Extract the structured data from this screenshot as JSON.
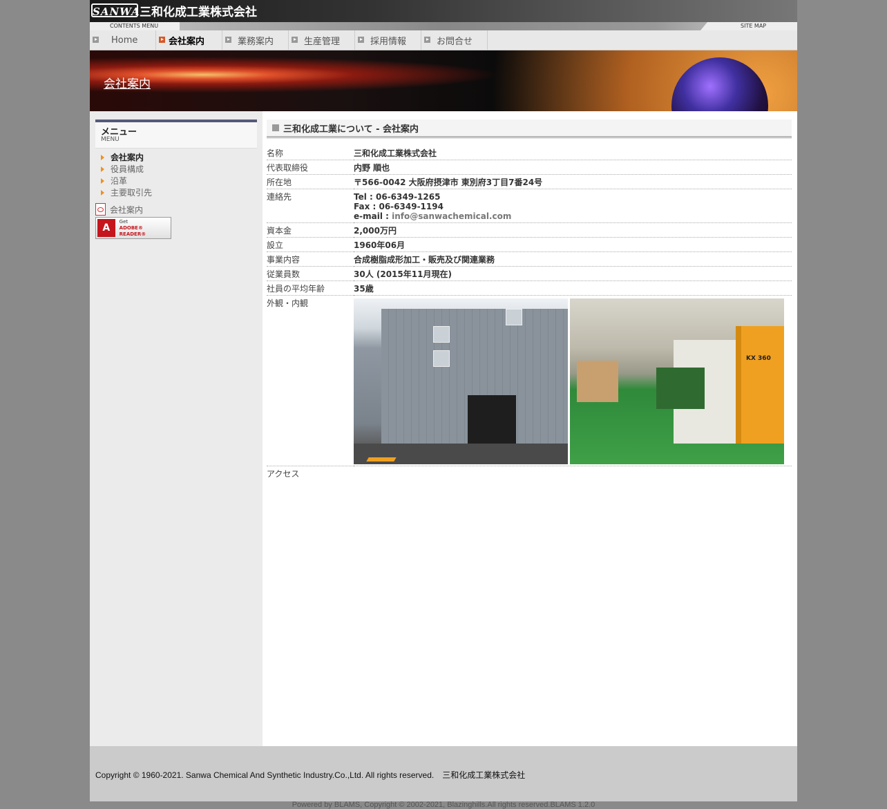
{
  "header": {
    "logo_mark": "SANWA",
    "logo_text": "三和化成工業株式会社",
    "contents_menu": "CONTENTS MENU",
    "site_map": "SITE MAP"
  },
  "nav": {
    "items": [
      {
        "label": "Home"
      },
      {
        "label": "会社案内"
      },
      {
        "label": "業務案内"
      },
      {
        "label": "生産管理"
      },
      {
        "label": "採用情報"
      },
      {
        "label": "お問合せ"
      }
    ]
  },
  "banner": {
    "title": "会社案内"
  },
  "sidebar": {
    "menu_title": "メニュー",
    "menu_sub": "MENU",
    "items": [
      {
        "label": "会社案内"
      },
      {
        "label": "役員構成"
      },
      {
        "label": "沿革"
      },
      {
        "label": "主要取引先"
      }
    ],
    "pdf_label": "会社案内",
    "adobe_get": "Get",
    "adobe_name": "ADOBE® READER®"
  },
  "main": {
    "section_title": "三和化成工業について - 会社案内",
    "rows": [
      {
        "key": "名称",
        "value": "三和化成工業株式会社"
      },
      {
        "key": "代表取締役",
        "value": "内野 順也"
      },
      {
        "key": "所在地",
        "value": "〒566-0042 大阪府摂津市 東別府3丁目7番24号"
      },
      {
        "key": "連絡先",
        "tel": "Tel : 06-6349-1265",
        "fax": "Fax : 06-6349-1194",
        "email_label": "e-mail : ",
        "email": "info@sanwachemical.com"
      },
      {
        "key": "資本金",
        "value": "2,000万円"
      },
      {
        "key": "設立",
        "value": "1960年06月"
      },
      {
        "key": "事業内容",
        "value": "合成樹脂成形加工・販売及び関連業務"
      },
      {
        "key": "従業員数",
        "value": "30人 (2015年11月現在)"
      },
      {
        "key": "社員の平均年齢",
        "value": "35歳"
      },
      {
        "key": "外観・内観",
        "photo_label": "KX 360"
      },
      {
        "key": "アクセス"
      }
    ]
  },
  "footer": {
    "copyright": "Copyright © 1960-2021. Sanwa Chemical And Synthetic Industry.Co.,Ltd. All rights reserved.　三和化成工業株式会社",
    "powered": "Powered by BLAMS, Copyright © 2002-2021, Blazinghills.All rights reserved.BLAMS 1.2.0"
  }
}
